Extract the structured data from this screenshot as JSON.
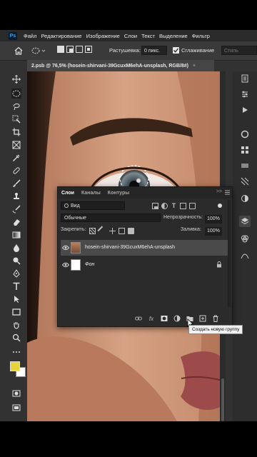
{
  "app": {
    "logo": "Ps"
  },
  "menubar": {
    "items": [
      "Файл",
      "Редактирование",
      "Изображение",
      "Слои",
      "Текст",
      "Выделение",
      "Фильтр"
    ]
  },
  "options_bar": {
    "feather_label": "Растушевка:",
    "feather_value": "0 пикс.",
    "antialias_label": "Сглаживание",
    "antialias_checked": true,
    "style_label": "Стиль"
  },
  "document": {
    "tab_title": "2.psb @ 76,5% (hosein-shirvani-39GcuxM6ehA-unsplash, RGB/8#)",
    "close": "×"
  },
  "layers_panel": {
    "tabs": [
      "Слои",
      "Каналы",
      "Контуры"
    ],
    "active_tab": "Слои",
    "collapse": ">>",
    "filter_kind": "Вид",
    "blend_mode": "Обычные",
    "opacity_label": "Непрозрачность:",
    "opacity_value": "100%",
    "lock_label": "Закрепить:",
    "fill_label": "Заливка:",
    "fill_value": "100%",
    "layers": [
      {
        "name": "hosein-shirvani-39GcuxM6ehA-unsplash",
        "visible": true,
        "selected": true,
        "smart_object": true
      },
      {
        "name": "Фон",
        "visible": true,
        "selected": false,
        "locked": true
      }
    ],
    "footer_icons": [
      "link-icon",
      "fx-icon",
      "mask-icon",
      "adjustment-icon",
      "group-icon",
      "new-layer-icon",
      "trash-icon"
    ],
    "fx_label": "fx"
  },
  "tooltip": {
    "text": "Создать новую группу"
  },
  "colors": {
    "foreground": "#e6d43a",
    "background": "#ffffff",
    "accent": "#31a8ff"
  }
}
